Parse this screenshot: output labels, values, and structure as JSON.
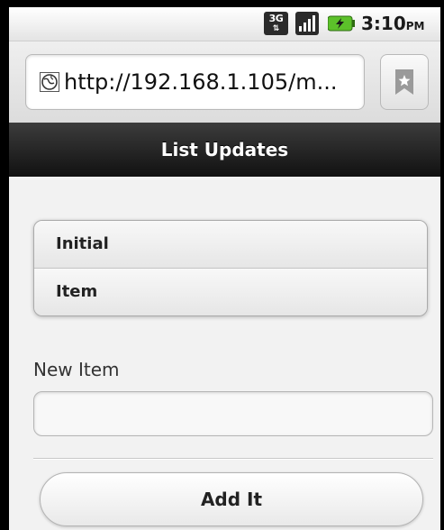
{
  "status_bar": {
    "network_type": "3G",
    "time": "3:10",
    "ampm": "PM"
  },
  "browser": {
    "url": "http://192.168.1.105/m..."
  },
  "header": {
    "title": "List Updates"
  },
  "list": {
    "items": [
      {
        "label": "Initial"
      },
      {
        "label": "Item"
      }
    ]
  },
  "form": {
    "new_item_label": "New Item",
    "new_item_value": "",
    "add_button_label": "Add It"
  },
  "icons": {
    "network": "3g-icon",
    "signal": "signal-strength-icon",
    "battery": "battery-charging-icon",
    "page": "globe-icon",
    "bookmark": "bookmark-star-icon"
  },
  "colors": {
    "header_bg": "#1f1f1f",
    "battery_green": "#5cc12a"
  }
}
